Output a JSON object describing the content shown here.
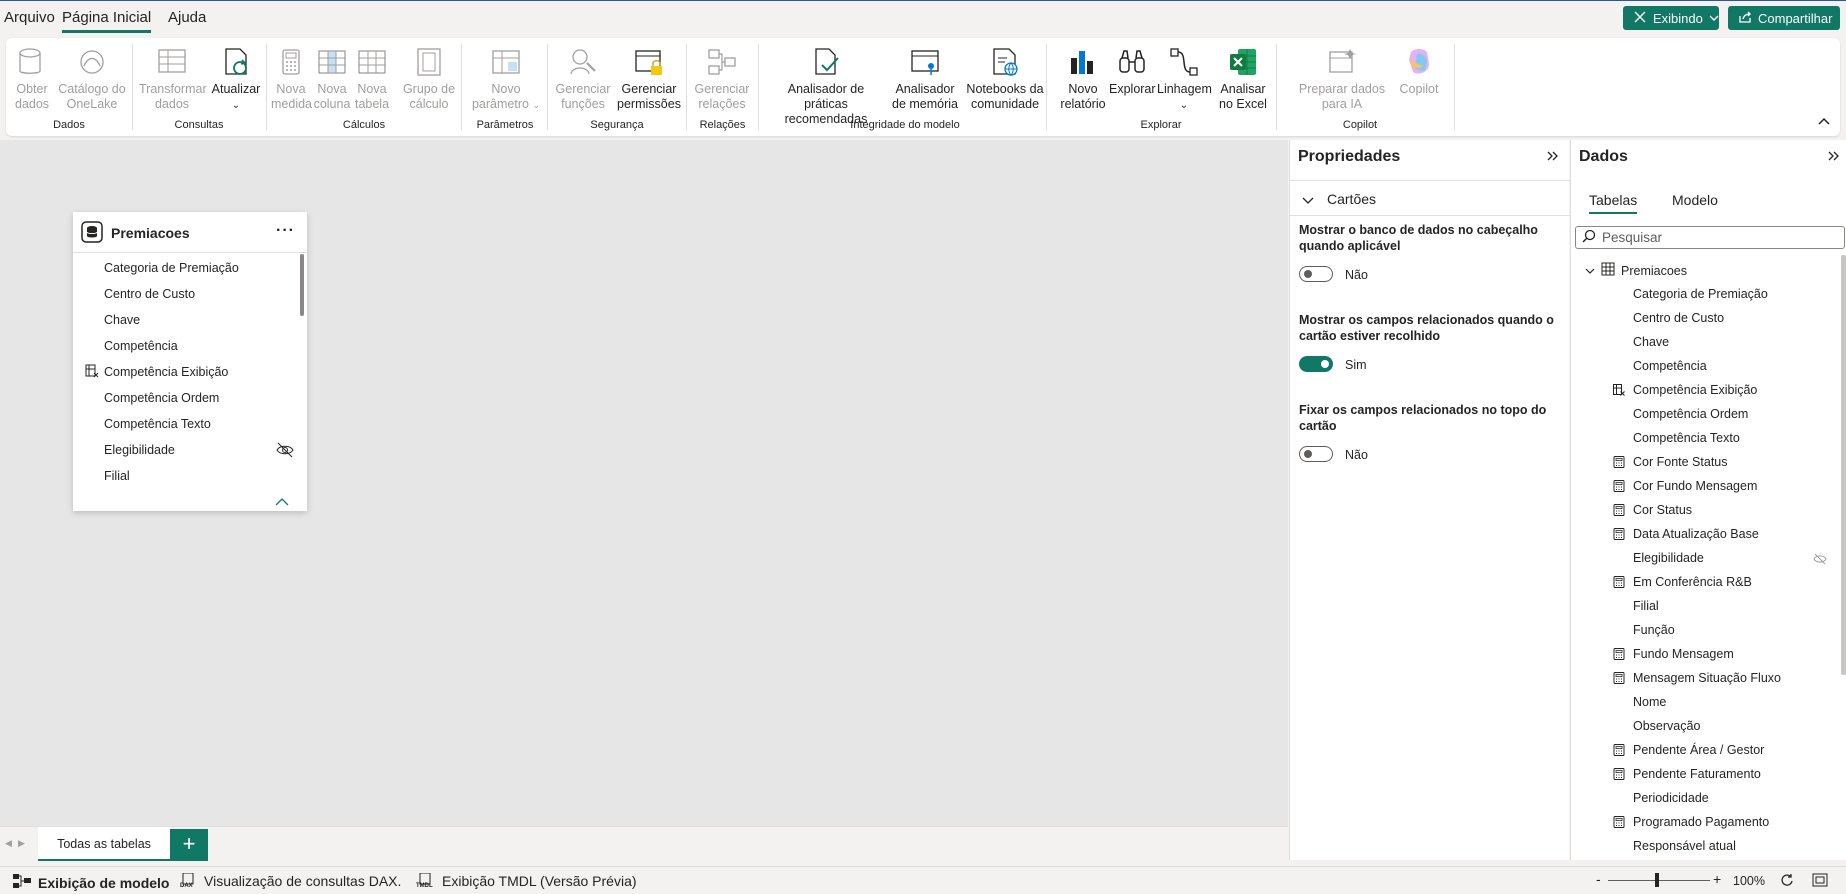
{
  "menu": {
    "tabs": [
      {
        "label": "Arquivo"
      },
      {
        "label": "Página Inicial"
      },
      {
        "label": "Ajuda"
      }
    ],
    "view_button": "Exibindo",
    "share_button": "Compartilhar"
  },
  "ribbon": {
    "groups": [
      {
        "label": "Dados",
        "buttons": [
          {
            "label": "Obter dados"
          },
          {
            "label": "Catálogo do OneLake"
          }
        ]
      },
      {
        "label": "Consultas",
        "buttons": [
          {
            "label": "Transformar dados"
          },
          {
            "label": "Atualizar"
          }
        ]
      },
      {
        "label": "Cálculos",
        "buttons": [
          {
            "label": "Nova medida"
          },
          {
            "label": "Nova coluna"
          },
          {
            "label": "Nova tabela"
          },
          {
            "label": "Grupo de cálculo"
          }
        ]
      },
      {
        "label": "Parâmetros",
        "buttons": [
          {
            "label": "Novo parâmetro"
          }
        ]
      },
      {
        "label": "Segurança",
        "buttons": [
          {
            "label": "Gerenciar funções"
          },
          {
            "label": "Gerenciar permissões"
          }
        ]
      },
      {
        "label": "Relações",
        "buttons": [
          {
            "label": "Gerenciar relações"
          }
        ]
      },
      {
        "label": "Integridade do modelo",
        "buttons": [
          {
            "label": "Analisador de práticas recomendadas"
          },
          {
            "label": "Analisador de memória"
          },
          {
            "label": "Notebooks da comunidade"
          }
        ]
      },
      {
        "label": "Explorar",
        "buttons": [
          {
            "label": "Novo relatório"
          },
          {
            "label": "Explorar"
          },
          {
            "label": "Linhagem"
          },
          {
            "label": "Analisar no Excel"
          }
        ]
      },
      {
        "label": "Copilot",
        "buttons": [
          {
            "label": "Preparar dados para IA"
          },
          {
            "label": "Copilot"
          }
        ]
      }
    ]
  },
  "card": {
    "title": "Premiacoes",
    "fields": [
      "Categoria de Premiação",
      "Centro de Custo",
      "Chave",
      "Competência",
      "Competência Exibição",
      "Competência Ordem",
      "Competência Texto",
      "Elegibilidade",
      "Filial"
    ]
  },
  "tabs": {
    "active": "Todas as tabelas",
    "add": "+"
  },
  "status": {
    "model_view": "Exibição de modelo",
    "dax_view": "Visualização de consultas DAX.",
    "tmdl_view": "Exibição TMDL (Versão Prévia)",
    "zoom": "100%",
    "dax_badge": "DAX",
    "tmdl_badge": "TMDL"
  },
  "properties": {
    "title": "Propriedades",
    "section": "Cartões",
    "items": [
      {
        "label": "Mostrar o banco de dados no cabeçalho quando aplicável",
        "value": "Não",
        "on": false
      },
      {
        "label": "Mostrar os campos relacionados quando o cartão estiver recolhido",
        "value": "Sim",
        "on": true
      },
      {
        "label": "Fixar os campos relacionados no topo do cartão",
        "value": "Não",
        "on": false
      }
    ]
  },
  "data_pane": {
    "title": "Dados",
    "tabs": [
      "Tabelas",
      "Modelo"
    ],
    "search_placeholder": "Pesquisar",
    "table": "Premiacoes",
    "fields": [
      {
        "name": "Categoria de Premiação",
        "icon": "none"
      },
      {
        "name": "Centro de Custo",
        "icon": "none"
      },
      {
        "name": "Chave",
        "icon": "none"
      },
      {
        "name": "Competência",
        "icon": "none"
      },
      {
        "name": "Competência Exibição",
        "icon": "calculated-column-icon"
      },
      {
        "name": "Competência Ordem",
        "icon": "none"
      },
      {
        "name": "Competência Texto",
        "icon": "none"
      },
      {
        "name": "Cor Fonte Status",
        "icon": "measure-icon"
      },
      {
        "name": "Cor Fundo Mensagem",
        "icon": "measure-icon"
      },
      {
        "name": "Cor Status",
        "icon": "measure-icon"
      },
      {
        "name": "Data Atualização Base",
        "icon": "measure-icon"
      },
      {
        "name": "Elegibilidade",
        "icon": "none"
      },
      {
        "name": "Em Conferência R&B",
        "icon": "measure-icon"
      },
      {
        "name": "Filial",
        "icon": "none"
      },
      {
        "name": "Função",
        "icon": "none"
      },
      {
        "name": "Fundo Mensagem",
        "icon": "measure-icon"
      },
      {
        "name": "Mensagem Situação Fluxo",
        "icon": "measure-icon"
      },
      {
        "name": "Nome",
        "icon": "none"
      },
      {
        "name": "Observação",
        "icon": "none"
      },
      {
        "name": "Pendente Área / Gestor",
        "icon": "measure-icon"
      },
      {
        "name": "Pendente Faturamento",
        "icon": "measure-icon"
      },
      {
        "name": "Periodicidade",
        "icon": "none"
      },
      {
        "name": "Programado Pagamento",
        "icon": "measure-icon"
      },
      {
        "name": "Responsável atual",
        "icon": "none"
      }
    ]
  }
}
